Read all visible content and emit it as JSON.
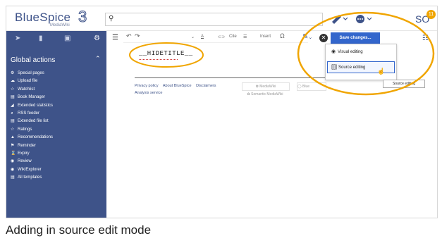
{
  "app": {
    "logo_text": "BlueSpice",
    "logo_sub": "MediaWiki",
    "logo_number": "3"
  },
  "topbar": {
    "search_placeholder": "",
    "search_icon": "search-icon",
    "avatar_initials": "SO",
    "notifications_count": "11"
  },
  "sidebar": {
    "tool_icons": [
      "navigation-icon",
      "pin-icon",
      "clipboard-icon",
      "gear-icon"
    ],
    "section_title": "Global actions",
    "items": [
      {
        "icon": "gear-icon",
        "label": "Special pages"
      },
      {
        "icon": "upload-icon",
        "label": "Upload file"
      },
      {
        "icon": "star-icon",
        "label": "Watchlist"
      },
      {
        "icon": "book-icon",
        "label": "Book Manager"
      },
      {
        "icon": "chart-icon",
        "label": "Extended statistics"
      },
      {
        "icon": "rss-icon",
        "label": "RSS feeder"
      },
      {
        "icon": "file-icon",
        "label": "Extended file list"
      },
      {
        "icon": "star-icon",
        "label": "Ratings"
      },
      {
        "icon": "thumbs-up-icon",
        "label": "Recommendations"
      },
      {
        "icon": "flag-icon",
        "label": "Reminder"
      },
      {
        "icon": "hourglass-icon",
        "label": "Expiry"
      },
      {
        "icon": "eye-icon",
        "label": "Review"
      },
      {
        "icon": "wiki-icon",
        "label": "WikiExplorer"
      },
      {
        "icon": "template-icon",
        "label": "All templates"
      }
    ]
  },
  "toolbar": {
    "undo": "↶",
    "redo": "↷",
    "format_a": "A",
    "link": "⊂⊃",
    "cite": "Cite",
    "list": "☰",
    "insert": "Insert",
    "omega": "Ω"
  },
  "editor": {
    "content": "__HIDETITLE__"
  },
  "footer": {
    "links": [
      "Privacy policy",
      "About BlueSpice",
      "Disclaimers"
    ],
    "links_line2": "Analysis service",
    "badge_mediawiki": "MediaWiki",
    "badge_smw": "Semantic MediaWiki",
    "badge_bluespice": "Blue"
  },
  "edit_tools": {
    "save_label": "Save changes...",
    "close_icon": "close-icon"
  },
  "dropdown": {
    "items": [
      {
        "icon": "eye-icon",
        "label": "Visual editing"
      },
      {
        "icon": "brackets-icon",
        "label": "Source editing"
      }
    ],
    "tooltip": "Source editing"
  },
  "caption": "Adding in source edit mode",
  "colors": {
    "brand": "#3e5389",
    "accent": "#3366cc",
    "highlight": "#f0a500"
  }
}
